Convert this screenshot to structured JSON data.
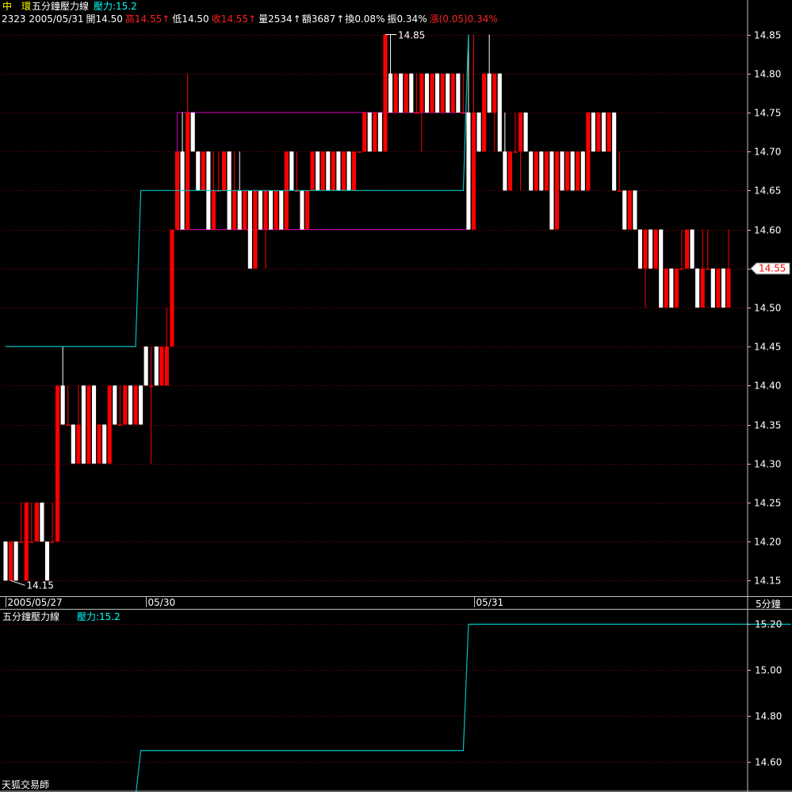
{
  "header": {
    "stock_name": "中　環",
    "indicator_title": "五分鐘壓力線",
    "pressure_label": "壓力:15.2",
    "code_date": "2323 2005/05/31",
    "open_text": "開14.50",
    "high_label": "高",
    "high_value": "14.55",
    "low_text": "低14.50",
    "close_label": "收",
    "close_value": "14.55",
    "up_arrow": "↑",
    "volume_text": "量2534",
    "amount_text": "額3687",
    "turnover_text": "換0.08%",
    "amplitude_text": "振0.34%",
    "change_text": "漲(0.05)0.34%"
  },
  "period_label": "5分鐘",
  "watermark": "天狐交易師",
  "colors": {
    "up": "#ff0000",
    "down": "#ffffff",
    "pressure_line": "#00c0c0",
    "box": "#c000c0",
    "grid": "#a00000",
    "axis": "#c0c0c0",
    "header_yellow": "#ffff00",
    "header_cyan": "#00ffff",
    "header_red": "#ff2020"
  },
  "chart_data": [
    {
      "type": "candlestick",
      "title": "五分鐘壓力線",
      "ylim": [
        14.13,
        14.88
      ],
      "yticks": [
        "14.85",
        "14.80",
        "14.75",
        "14.70",
        "14.65",
        "14.60",
        "14.55",
        "14.50",
        "14.45",
        "14.40",
        "14.35",
        "14.30",
        "14.25",
        "14.20",
        "14.15"
      ],
      "date_labels": [
        {
          "label": "2005/05/27",
          "bar": 0
        },
        {
          "label": "05/30",
          "bar": 27
        },
        {
          "label": "05/31",
          "bar": 90
        }
      ],
      "current_price": "14.55",
      "high_annotation": "14.85",
      "low_annotation": "14.15",
      "pressure_levels": [
        {
          "value": 14.45,
          "from": 0,
          "to": 25
        },
        {
          "value": 14.65,
          "from": 26,
          "to": 88
        },
        {
          "value": 14.85,
          "from": 89,
          "to": 89
        }
      ],
      "boxes": [
        {
          "top": 14.75,
          "bottom": 14.6,
          "from": 33,
          "to": 89
        }
      ],
      "bars": [
        [
          14.2,
          14.2,
          14.15,
          14.15
        ],
        [
          14.15,
          14.2,
          14.15,
          14.2
        ],
        [
          14.2,
          14.2,
          14.15,
          14.15
        ],
        [
          14.2,
          14.25,
          14.2,
          14.2
        ],
        [
          14.15,
          14.25,
          14.15,
          14.25
        ],
        [
          14.2,
          14.25,
          14.2,
          14.2
        ],
        [
          14.2,
          14.25,
          14.2,
          14.25
        ],
        [
          14.25,
          14.25,
          14.2,
          14.2
        ],
        [
          14.2,
          14.2,
          14.15,
          14.15
        ],
        [
          14.2,
          14.25,
          14.2,
          14.2
        ],
        [
          14.2,
          14.4,
          14.2,
          14.4
        ],
        [
          14.4,
          14.45,
          14.35,
          14.35
        ],
        [
          14.35,
          14.4,
          14.35,
          14.35
        ],
        [
          14.35,
          14.35,
          14.3,
          14.3
        ],
        [
          14.3,
          14.4,
          14.3,
          14.35
        ],
        [
          14.4,
          14.4,
          14.3,
          14.3
        ],
        [
          14.3,
          14.4,
          14.3,
          14.4
        ],
        [
          14.4,
          14.4,
          14.3,
          14.3
        ],
        [
          14.3,
          14.35,
          14.3,
          14.35
        ],
        [
          14.35,
          14.35,
          14.3,
          14.3
        ],
        [
          14.3,
          14.4,
          14.3,
          14.4
        ],
        [
          14.4,
          14.4,
          14.35,
          14.35
        ],
        [
          14.35,
          14.4,
          14.35,
          14.35
        ],
        [
          14.35,
          14.4,
          14.35,
          14.4
        ],
        [
          14.4,
          14.4,
          14.35,
          14.35
        ],
        [
          14.35,
          14.4,
          14.35,
          14.4
        ],
        [
          14.4,
          14.4,
          14.35,
          14.35
        ],
        [
          14.45,
          14.45,
          14.4,
          14.4
        ],
        [
          14.4,
          14.45,
          14.3,
          14.4
        ],
        [
          14.45,
          14.45,
          14.4,
          14.4
        ],
        [
          14.4,
          14.45,
          14.4,
          14.45
        ],
        [
          14.4,
          14.5,
          14.4,
          14.45
        ],
        [
          14.45,
          14.6,
          14.45,
          14.6
        ],
        [
          14.6,
          14.7,
          14.6,
          14.7
        ],
        [
          14.7,
          14.75,
          14.6,
          14.6
        ],
        [
          14.6,
          14.8,
          14.6,
          14.75
        ],
        [
          14.75,
          14.75,
          14.7,
          14.7
        ],
        [
          14.7,
          14.7,
          14.65,
          14.65
        ],
        [
          14.65,
          14.7,
          14.65,
          14.7
        ],
        [
          14.7,
          14.7,
          14.6,
          14.6
        ],
        [
          14.6,
          14.7,
          14.6,
          14.65
        ],
        [
          14.65,
          14.7,
          14.65,
          14.65
        ],
        [
          14.65,
          14.7,
          14.65,
          14.7
        ],
        [
          14.7,
          14.7,
          14.6,
          14.6
        ],
        [
          14.6,
          14.7,
          14.6,
          14.65
        ],
        [
          14.65,
          14.7,
          14.6,
          14.6
        ],
        [
          14.6,
          14.65,
          14.6,
          14.65
        ],
        [
          14.65,
          14.65,
          14.55,
          14.55
        ],
        [
          14.55,
          14.65,
          14.55,
          14.65
        ],
        [
          14.65,
          14.65,
          14.6,
          14.6
        ],
        [
          14.6,
          14.65,
          14.55,
          14.65
        ],
        [
          14.65,
          14.65,
          14.6,
          14.6
        ],
        [
          14.6,
          14.65,
          14.6,
          14.65
        ],
        [
          14.65,
          14.65,
          14.6,
          14.6
        ],
        [
          14.6,
          14.7,
          14.6,
          14.7
        ],
        [
          14.7,
          14.7,
          14.65,
          14.65
        ],
        [
          14.65,
          14.7,
          14.65,
          14.65
        ],
        [
          14.65,
          14.65,
          14.6,
          14.6
        ],
        [
          14.6,
          14.65,
          14.6,
          14.65
        ],
        [
          14.65,
          14.7,
          14.65,
          14.7
        ],
        [
          14.7,
          14.7,
          14.65,
          14.65
        ],
        [
          14.65,
          14.7,
          14.65,
          14.7
        ],
        [
          14.7,
          14.7,
          14.65,
          14.65
        ],
        [
          14.65,
          14.7,
          14.65,
          14.7
        ],
        [
          14.7,
          14.7,
          14.65,
          14.65
        ],
        [
          14.65,
          14.7,
          14.65,
          14.7
        ],
        [
          14.7,
          14.7,
          14.65,
          14.65
        ],
        [
          14.65,
          14.7,
          14.65,
          14.7
        ],
        [
          14.7,
          14.7,
          14.7,
          14.7
        ],
        [
          14.7,
          14.75,
          14.7,
          14.75
        ],
        [
          14.75,
          14.75,
          14.7,
          14.7
        ],
        [
          14.7,
          14.75,
          14.7,
          14.75
        ],
        [
          14.75,
          14.75,
          14.7,
          14.7
        ],
        [
          14.7,
          14.85,
          14.7,
          14.85
        ],
        [
          14.8,
          14.85,
          14.75,
          14.75
        ],
        [
          14.75,
          14.8,
          14.75,
          14.8
        ],
        [
          14.8,
          14.8,
          14.75,
          14.75
        ],
        [
          14.75,
          14.8,
          14.75,
          14.8
        ],
        [
          14.8,
          14.8,
          14.75,
          14.75
        ],
        [
          14.75,
          14.8,
          14.75,
          14.75
        ],
        [
          14.75,
          14.8,
          14.7,
          14.8
        ],
        [
          14.8,
          14.8,
          14.75,
          14.75
        ],
        [
          14.75,
          14.8,
          14.75,
          14.8
        ],
        [
          14.8,
          14.8,
          14.75,
          14.75
        ],
        [
          14.75,
          14.8,
          14.75,
          14.8
        ],
        [
          14.8,
          14.8,
          14.75,
          14.75
        ],
        [
          14.75,
          14.8,
          14.75,
          14.8
        ],
        [
          14.8,
          14.8,
          14.75,
          14.75
        ],
        [
          14.75,
          14.8,
          14.75,
          14.75
        ],
        [
          14.75,
          14.85,
          14.6,
          14.6
        ],
        [
          14.6,
          14.85,
          14.6,
          14.75
        ],
        [
          14.75,
          14.75,
          14.7,
          14.7
        ],
        [
          14.7,
          14.8,
          14.7,
          14.8
        ],
        [
          14.8,
          14.85,
          14.75,
          14.75
        ],
        [
          14.75,
          14.8,
          14.7,
          14.8
        ],
        [
          14.8,
          14.8,
          14.7,
          14.7
        ],
        [
          14.7,
          14.75,
          14.65,
          14.65
        ],
        [
          14.65,
          14.7,
          14.65,
          14.7
        ],
        [
          14.7,
          14.75,
          14.7,
          14.7
        ],
        [
          14.7,
          14.75,
          14.65,
          14.75
        ],
        [
          14.75,
          14.75,
          14.7,
          14.7
        ],
        [
          14.7,
          14.7,
          14.65,
          14.65
        ],
        [
          14.65,
          14.7,
          14.65,
          14.7
        ],
        [
          14.7,
          14.7,
          14.65,
          14.65
        ],
        [
          14.65,
          14.7,
          14.65,
          14.7
        ],
        [
          14.7,
          14.7,
          14.6,
          14.6
        ],
        [
          14.6,
          14.7,
          14.6,
          14.7
        ],
        [
          14.7,
          14.7,
          14.65,
          14.65
        ],
        [
          14.65,
          14.7,
          14.65,
          14.7
        ],
        [
          14.7,
          14.7,
          14.65,
          14.65
        ],
        [
          14.65,
          14.7,
          14.65,
          14.7
        ],
        [
          14.7,
          14.7,
          14.65,
          14.65
        ],
        [
          14.65,
          14.75,
          14.65,
          14.75
        ],
        [
          14.75,
          14.75,
          14.7,
          14.7
        ],
        [
          14.7,
          14.75,
          14.7,
          14.75
        ],
        [
          14.75,
          14.75,
          14.7,
          14.7
        ],
        [
          14.7,
          14.75,
          14.7,
          14.75
        ],
        [
          14.75,
          14.75,
          14.65,
          14.65
        ],
        [
          14.65,
          14.7,
          14.65,
          14.65
        ],
        [
          14.65,
          14.65,
          14.6,
          14.6
        ],
        [
          14.6,
          14.65,
          14.6,
          14.65
        ],
        [
          14.65,
          14.65,
          14.6,
          14.6
        ],
        [
          14.6,
          14.6,
          14.55,
          14.55
        ],
        [
          14.55,
          14.6,
          14.5,
          14.6
        ],
        [
          14.6,
          14.6,
          14.55,
          14.55
        ],
        [
          14.55,
          14.6,
          14.55,
          14.6
        ],
        [
          14.6,
          14.6,
          14.5,
          14.5
        ],
        [
          14.5,
          14.55,
          14.5,
          14.55
        ],
        [
          14.55,
          14.55,
          14.5,
          14.5
        ],
        [
          14.5,
          14.55,
          14.5,
          14.55
        ],
        [
          14.55,
          14.6,
          14.55,
          14.55
        ],
        [
          14.55,
          14.6,
          14.55,
          14.6
        ],
        [
          14.6,
          14.6,
          14.55,
          14.55
        ],
        [
          14.55,
          14.55,
          14.5,
          14.5
        ],
        [
          14.5,
          14.6,
          14.5,
          14.55
        ],
        [
          14.55,
          14.6,
          14.55,
          14.55
        ],
        [
          14.55,
          14.55,
          14.5,
          14.5
        ],
        [
          14.5,
          14.55,
          14.5,
          14.55
        ],
        [
          14.55,
          14.55,
          14.5,
          14.5
        ],
        [
          14.5,
          14.6,
          14.5,
          14.55
        ]
      ]
    },
    {
      "type": "line",
      "title": "五分鐘壓力線",
      "series": [
        {
          "name": "壓力",
          "values": [
            14.45,
            14.65,
            15.2
          ]
        }
      ],
      "steps": [
        {
          "value": 14.45,
          "from": 0,
          "to": 25
        },
        {
          "value": 14.65,
          "from": 26,
          "to": 88
        },
        {
          "value": 15.2,
          "from": 89,
          "to": 151
        }
      ],
      "ylim": [
        14.48,
        15.26
      ],
      "yticks": [
        "15.20",
        "15.00",
        "14.80",
        "14.60"
      ]
    }
  ]
}
